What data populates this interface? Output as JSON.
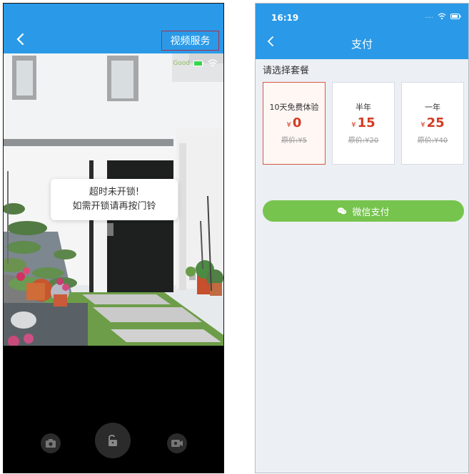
{
  "left_screen": {
    "header": {
      "service_label": "视频服务"
    },
    "camera": {
      "dialog_line1": "超时未开锁!",
      "dialog_line2": "如需开锁请再按门铃",
      "signal_text": "Good"
    },
    "controls": {
      "camera_icon": "camera-icon",
      "unlock_icon": "unlock-icon",
      "video_icon": "video-icon"
    }
  },
  "right_screen": {
    "status_time": "16:19",
    "title": "支付",
    "plan_label": "请选择套餐",
    "plans": [
      {
        "name": "10天免费体验",
        "currency": "¥",
        "amount": "0",
        "original": "原价:¥5",
        "selected": true
      },
      {
        "name": "半年",
        "currency": "¥",
        "amount": "15",
        "original": "原价:¥20",
        "selected": false
      },
      {
        "name": "一年",
        "currency": "¥",
        "amount": "25",
        "original": "原价:¥40",
        "selected": false
      }
    ],
    "pay_button": "微信支付"
  },
  "colors": {
    "header_blue": "#2a9ae8",
    "selected_red": "#d55a45",
    "price_red": "#d23c24",
    "wechat_green": "#76c44d"
  }
}
